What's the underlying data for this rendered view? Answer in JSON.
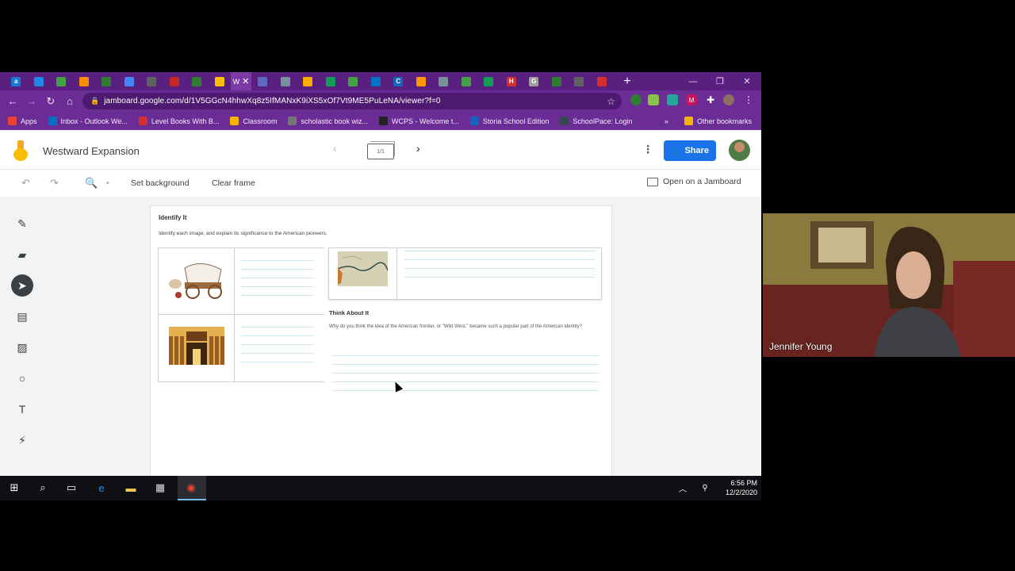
{
  "browser": {
    "tabs": [
      {
        "icon": "a-icon",
        "color": "#1976d2",
        "label": "a"
      },
      {
        "icon": "edge-like-icon",
        "color": "#1e88e5",
        "label": ""
      },
      {
        "icon": "drive-icon",
        "color": "#43a047",
        "label": ""
      },
      {
        "icon": "box-icon",
        "color": "#fb8c00",
        "label": ""
      },
      {
        "icon": "shield-icon",
        "color": "#2e7d32",
        "label": ""
      },
      {
        "icon": "docs-icon",
        "color": "#4285f4",
        "label": ""
      },
      {
        "icon": "globe-icon",
        "color": "#616161",
        "label": ""
      },
      {
        "icon": "app-icon",
        "color": "#c62828",
        "label": ""
      },
      {
        "icon": "shield-icon",
        "color": "#2e7d32",
        "label": ""
      },
      {
        "icon": "jamboard-icon",
        "color": "#fbbc04",
        "label": ""
      }
    ],
    "active_tab_label": "W",
    "tabs_after": [
      {
        "icon": "list-icon",
        "color": "#5c6bc0",
        "label": ""
      },
      {
        "icon": "image-icon",
        "color": "#78909c",
        "label": ""
      },
      {
        "icon": "slides-icon",
        "color": "#f9ab00",
        "label": ""
      },
      {
        "icon": "sheets-icon",
        "color": "#0f9d58",
        "label": ""
      },
      {
        "icon": "drive-icon",
        "color": "#43a047",
        "label": ""
      },
      {
        "icon": "outlook-icon",
        "color": "#0072c6",
        "label": ""
      },
      {
        "icon": "c-icon",
        "color": "#1565c0",
        "label": "C"
      },
      {
        "icon": "cube-icon",
        "color": "#ff9800",
        "label": ""
      },
      {
        "icon": "grid-icon",
        "color": "#78909c",
        "label": ""
      },
      {
        "icon": "drive-icon",
        "color": "#43a047",
        "label": ""
      },
      {
        "icon": "sheets-icon",
        "color": "#0f9d58",
        "label": ""
      },
      {
        "icon": "h-icon",
        "color": "#d32f2f",
        "label": "H"
      },
      {
        "icon": "google-icon",
        "color": "#9e9e9e",
        "label": "G"
      },
      {
        "icon": "shield-icon",
        "color": "#2e7d32",
        "label": ""
      },
      {
        "icon": "globe-icon",
        "color": "#616161",
        "label": ""
      },
      {
        "icon": "record-icon",
        "color": "#d32f2f",
        "label": ""
      }
    ],
    "url": "jamboard.google.com/d/1V5GGcN4hhwXq8z5IfMANxK9iXS5xOf7Vt9ME5PuLeNA/viewer?f=0",
    "bookmarks": [
      {
        "label": "Apps",
        "icon": "apps-icon",
        "color": "#ea4335"
      },
      {
        "label": "Inbox - Outlook We...",
        "icon": "outlook-icon",
        "color": "#0072c6"
      },
      {
        "label": "Level Books With B...",
        "icon": "s-icon",
        "color": "#d32f2f"
      },
      {
        "label": "Classroom",
        "icon": "classroom-icon",
        "color": "#f4b400"
      },
      {
        "label": "scholastic book wiz...",
        "icon": "google-icon",
        "color": "#757575"
      },
      {
        "label": "WCPS - Welcome t...",
        "icon": "w-icon",
        "color": "#222222"
      },
      {
        "label": "Storia School Edition",
        "icon": "storia-icon",
        "color": "#1565c0"
      },
      {
        "label": "SchoolPace: Login",
        "icon": "schoolpace-icon",
        "color": "#37474f"
      }
    ],
    "bookmarks_more": "»",
    "other_bookmarks": "Other bookmarks"
  },
  "jamboard": {
    "title": "Westward Expansion",
    "frame_counter": "1/1",
    "share_label": "Share",
    "set_background": "Set background",
    "clear_frame": "Clear frame",
    "open_on_jamboard": "Open on a Jamboard",
    "accent": "#1a73e8"
  },
  "worksheet": {
    "identify_title": "Identify It",
    "identify_sub": "Identify each image, and explain its significance to the American pioneers.",
    "think_title": "Think About It",
    "think_question": "Why do you think the idea of the American frontier, or \"Wild West,\" became such a popular part of the American identity?"
  },
  "video": {
    "participant_name": "Jennifer Young"
  },
  "taskbar": {
    "time": "6:56 PM",
    "date": "12/2/2020"
  }
}
